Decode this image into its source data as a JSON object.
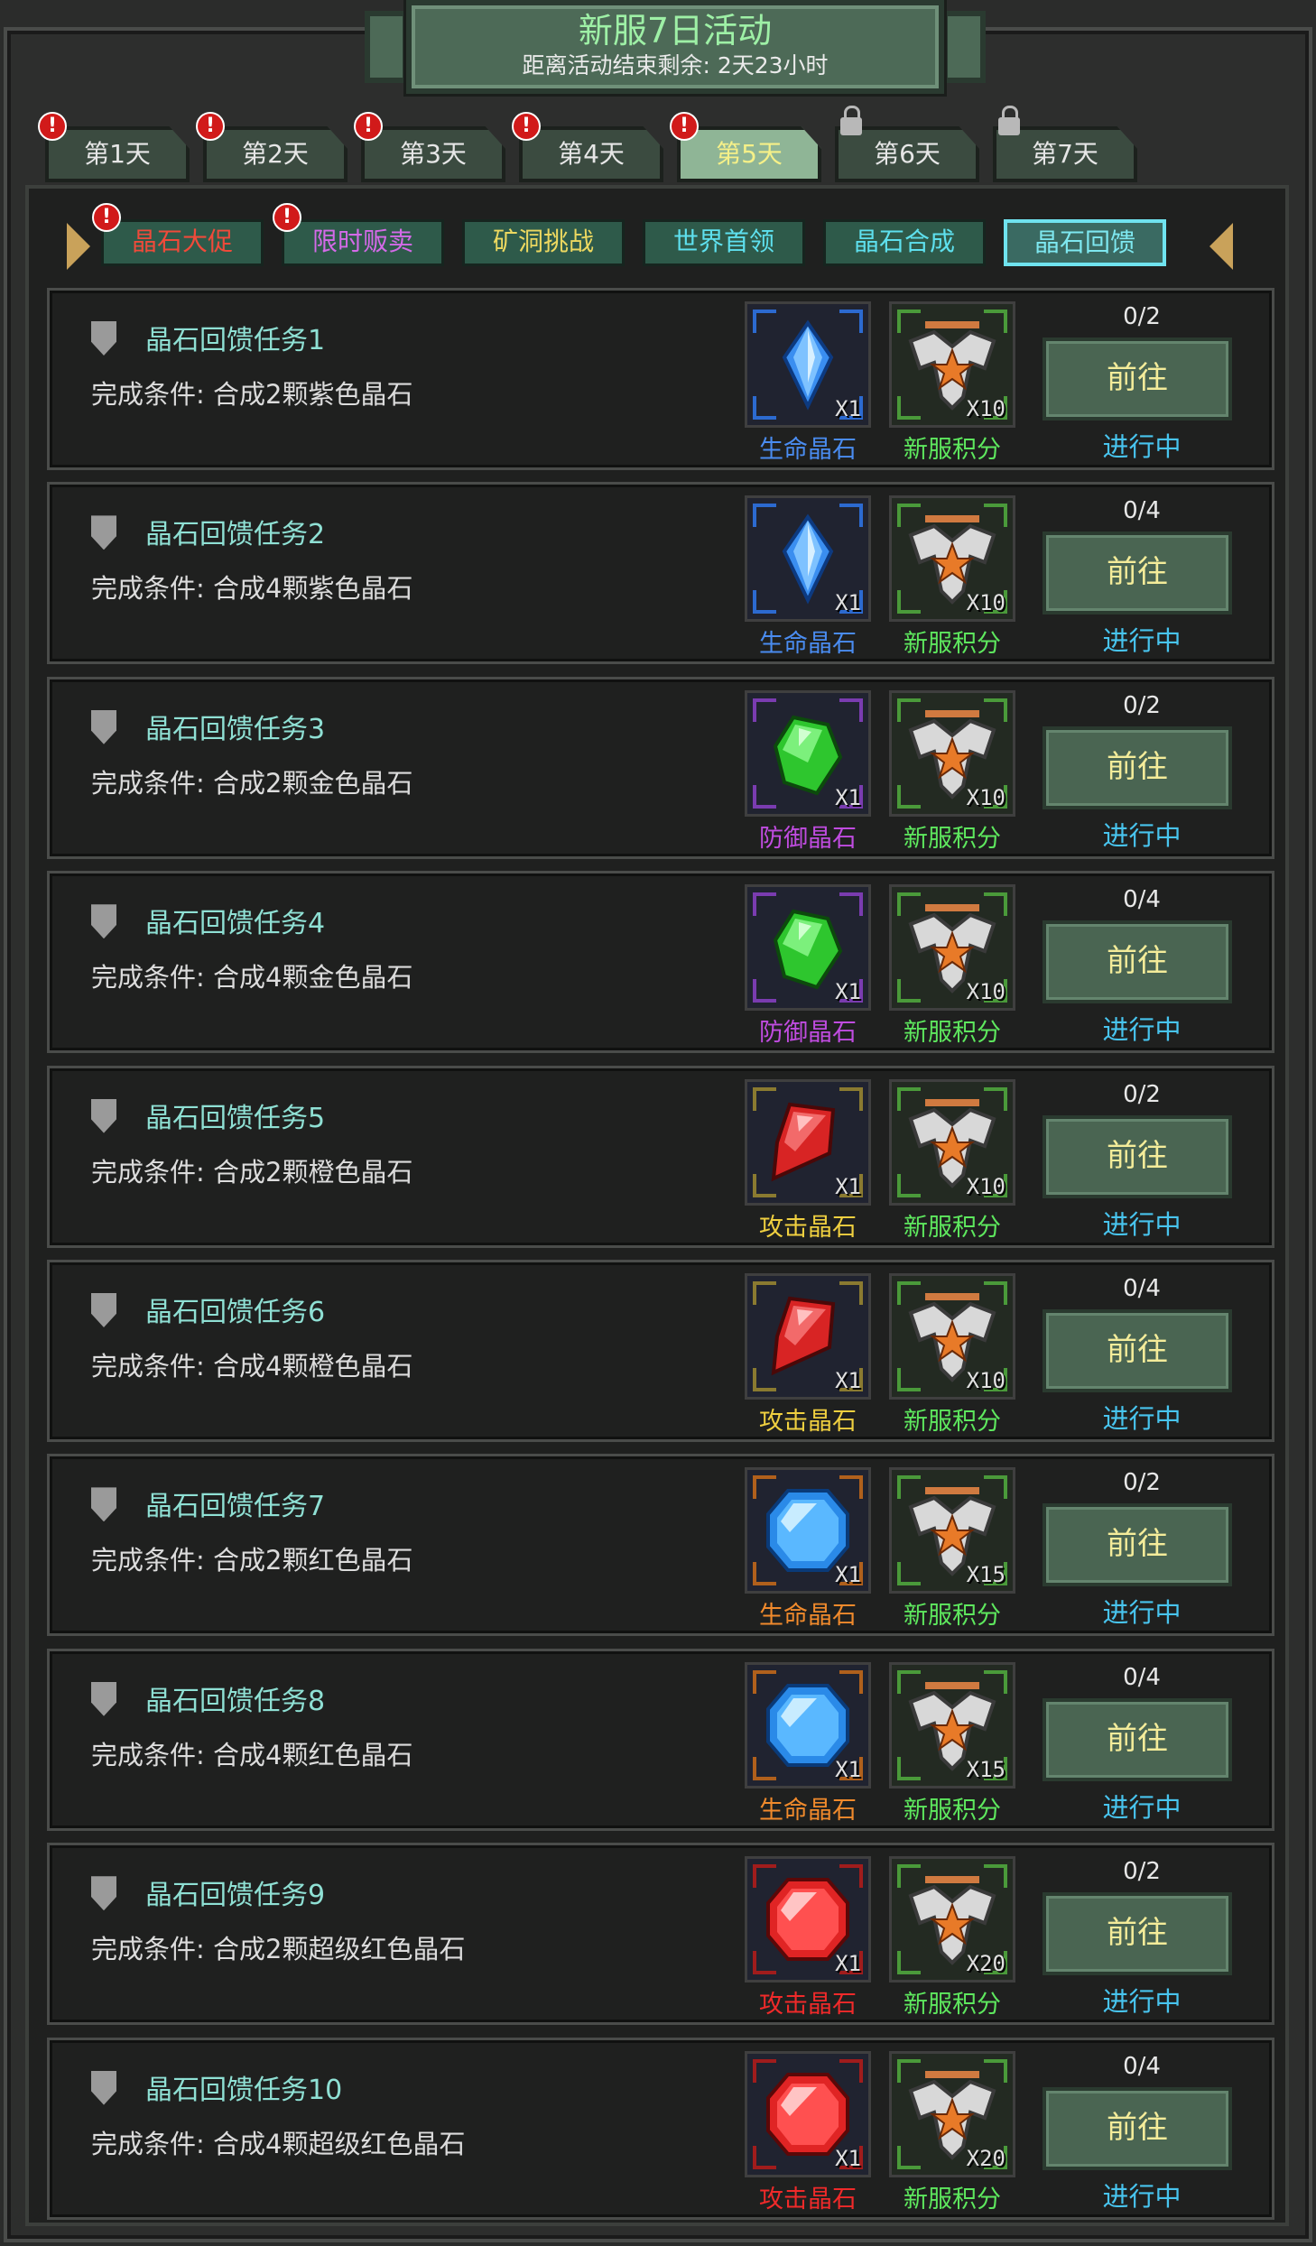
{
  "header": {
    "title": "新服7日活动",
    "subtitle": "距离活动结束剩余: 2天23小时"
  },
  "day_tabs": [
    {
      "label": "第1天",
      "alert": true,
      "locked": false,
      "active": false
    },
    {
      "label": "第2天",
      "alert": true,
      "locked": false,
      "active": false
    },
    {
      "label": "第3天",
      "alert": true,
      "locked": false,
      "active": false
    },
    {
      "label": "第4天",
      "alert": true,
      "locked": false,
      "active": false
    },
    {
      "label": "第5天",
      "alert": true,
      "locked": false,
      "active": true
    },
    {
      "label": "第6天",
      "alert": false,
      "locked": true,
      "active": false
    },
    {
      "label": "第7天",
      "alert": false,
      "locked": true,
      "active": false
    }
  ],
  "alert_glyph": "!",
  "sub_tabs": [
    {
      "label": "晶石大促",
      "color": "#f04a3a",
      "alert": true,
      "active": false
    },
    {
      "label": "限时贩卖",
      "color": "#d46ae8",
      "alert": true,
      "active": false
    },
    {
      "label": "矿洞挑战",
      "color": "#ecd860",
      "alert": false,
      "active": false
    },
    {
      "label": "世界首领",
      "color": "#5ee0ee",
      "alert": false,
      "active": false
    },
    {
      "label": "晶石合成",
      "color": "#5ee0ee",
      "alert": false,
      "active": false
    },
    {
      "label": "晶石回馈",
      "color": "#7ee8f0",
      "alert": false,
      "active": true
    }
  ],
  "reward_points": {
    "name": "新服积分",
    "color": "#5ee85e",
    "icon": "eagle-emblem-icon"
  },
  "tasks": [
    {
      "title": "晶石回馈任务1",
      "condition": "完成条件: 合成2颗紫色晶石",
      "progress": "0/2",
      "button": "前往",
      "status": "进行中",
      "gem": {
        "name": "生命晶石",
        "name_color": "#4a8cf0",
        "qty": "X1",
        "shape": "blue-diamond",
        "frame": "#2c6ad0"
      },
      "points_qty": "X10"
    },
    {
      "title": "晶石回馈任务2",
      "condition": "完成条件: 合成4颗紫色晶石",
      "progress": "0/4",
      "button": "前往",
      "status": "进行中",
      "gem": {
        "name": "生命晶石",
        "name_color": "#4a8cf0",
        "qty": "X1",
        "shape": "blue-diamond",
        "frame": "#2c6ad0"
      },
      "points_qty": "X10"
    },
    {
      "title": "晶石回馈任务3",
      "condition": "完成条件: 合成2颗金色晶石",
      "progress": "0/2",
      "button": "前往",
      "status": "进行中",
      "gem": {
        "name": "防御晶石",
        "name_color": "#c04ce0",
        "qty": "X1",
        "shape": "green-crystal",
        "frame": "#7a3cb0"
      },
      "points_qty": "X10"
    },
    {
      "title": "晶石回馈任务4",
      "condition": "完成条件: 合成4颗金色晶石",
      "progress": "0/4",
      "button": "前往",
      "status": "进行中",
      "gem": {
        "name": "防御晶石",
        "name_color": "#c04ce0",
        "qty": "X1",
        "shape": "green-crystal",
        "frame": "#7a3cb0"
      },
      "points_qty": "X10"
    },
    {
      "title": "晶石回馈任务5",
      "condition": "完成条件: 合成2颗橙色晶石",
      "progress": "0/2",
      "button": "前往",
      "status": "进行中",
      "gem": {
        "name": "攻击晶石",
        "name_color": "#f0d040",
        "qty": "X1",
        "shape": "red-shard",
        "frame": "#8a7a30"
      },
      "points_qty": "X10"
    },
    {
      "title": "晶石回馈任务6",
      "condition": "完成条件: 合成4颗橙色晶石",
      "progress": "0/4",
      "button": "前往",
      "status": "进行中",
      "gem": {
        "name": "攻击晶石",
        "name_color": "#f0d040",
        "qty": "X1",
        "shape": "red-shard",
        "frame": "#8a7a30"
      },
      "points_qty": "X10"
    },
    {
      "title": "晶石回馈任务7",
      "condition": "完成条件: 合成2颗红色晶石",
      "progress": "0/2",
      "button": "前往",
      "status": "进行中",
      "gem": {
        "name": "生命晶石",
        "name_color": "#f08a2c",
        "qty": "X1",
        "shape": "blue-octagon",
        "frame": "#b0601c"
      },
      "points_qty": "X15"
    },
    {
      "title": "晶石回馈任务8",
      "condition": "完成条件: 合成4颗红色晶石",
      "progress": "0/4",
      "button": "前往",
      "status": "进行中",
      "gem": {
        "name": "生命晶石",
        "name_color": "#f08a2c",
        "qty": "X1",
        "shape": "blue-octagon",
        "frame": "#b0601c"
      },
      "points_qty": "X15"
    },
    {
      "title": "晶石回馈任务9",
      "condition": "完成条件: 合成2颗超级红色晶石",
      "progress": "0/2",
      "button": "前往",
      "status": "进行中",
      "gem": {
        "name": "攻击晶石",
        "name_color": "#f02a2a",
        "qty": "X1",
        "shape": "red-octagon",
        "frame": "#a01c1c"
      },
      "points_qty": "X20"
    },
    {
      "title": "晶石回馈任务10",
      "condition": "完成条件: 合成4颗超级红色晶石",
      "progress": "0/4",
      "button": "前往",
      "status": "进行中",
      "gem": {
        "name": "攻击晶石",
        "name_color": "#f02a2a",
        "qty": "X1",
        "shape": "red-octagon",
        "frame": "#a01c1c"
      },
      "points_qty": "X20"
    }
  ]
}
